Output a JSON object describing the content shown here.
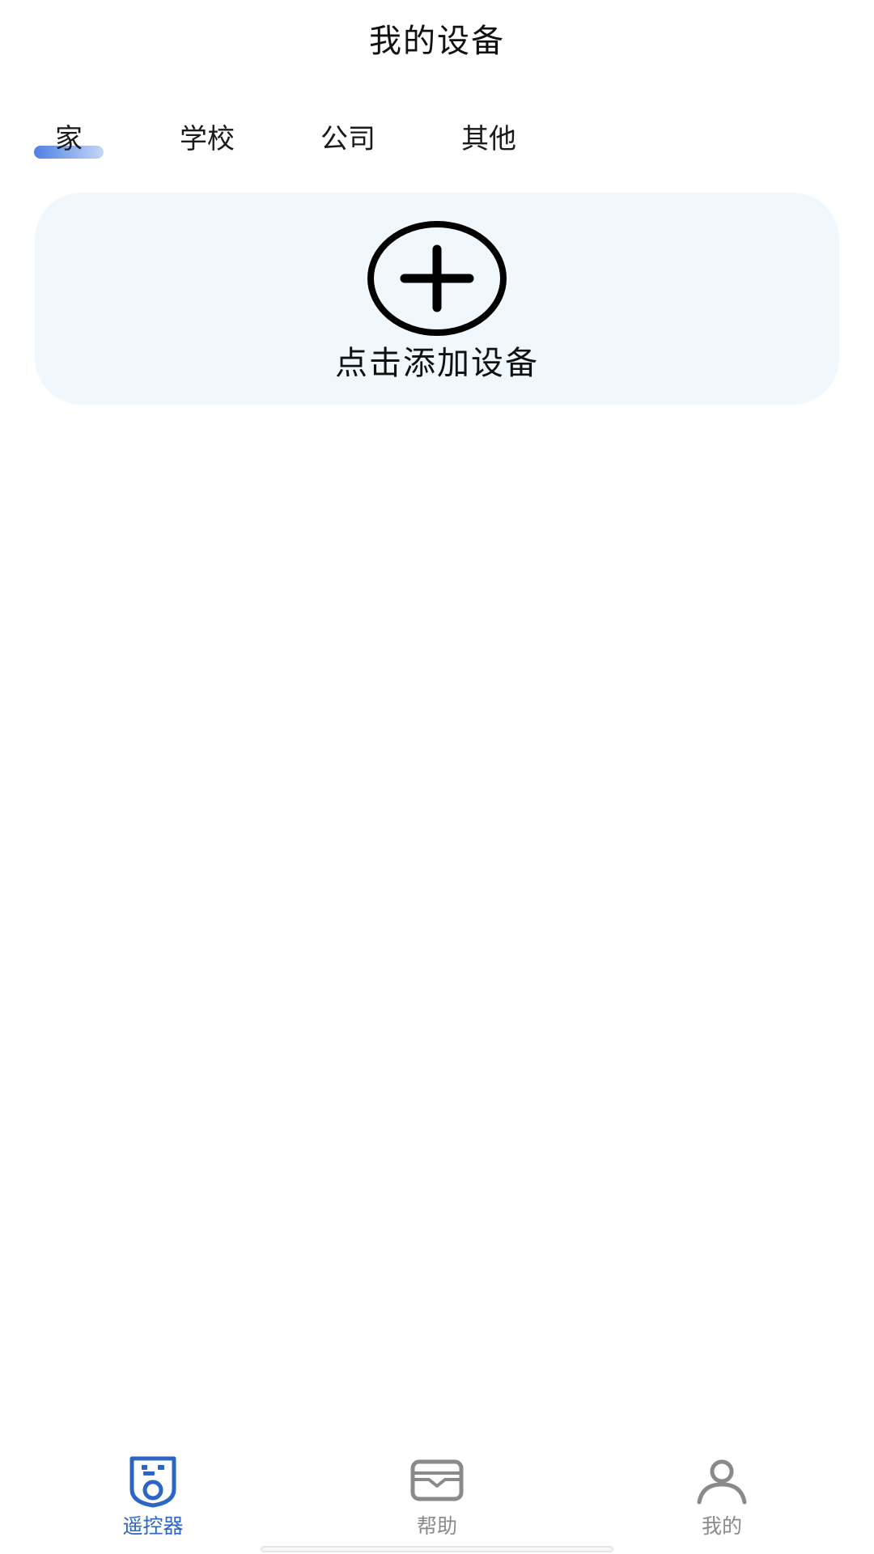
{
  "header": {
    "title": "我的设备"
  },
  "tabs": [
    {
      "label": "家",
      "active": true
    },
    {
      "label": "学校",
      "active": false
    },
    {
      "label": "公司",
      "active": false
    },
    {
      "label": "其他",
      "active": false
    }
  ],
  "add_device": {
    "label": "点击添加设备",
    "icon": "plus-circle-icon"
  },
  "bottom_nav": {
    "items": [
      {
        "label": "遥控器",
        "icon": "remote-control-icon",
        "active": true
      },
      {
        "label": "帮助",
        "icon": "help-card-icon",
        "active": false
      },
      {
        "label": "我的",
        "icon": "user-profile-icon",
        "active": false
      }
    ]
  },
  "colors": {
    "accent": "#2c65c4",
    "card_background": "#f0f7fd",
    "inactive_text": "#8a8a8a"
  }
}
